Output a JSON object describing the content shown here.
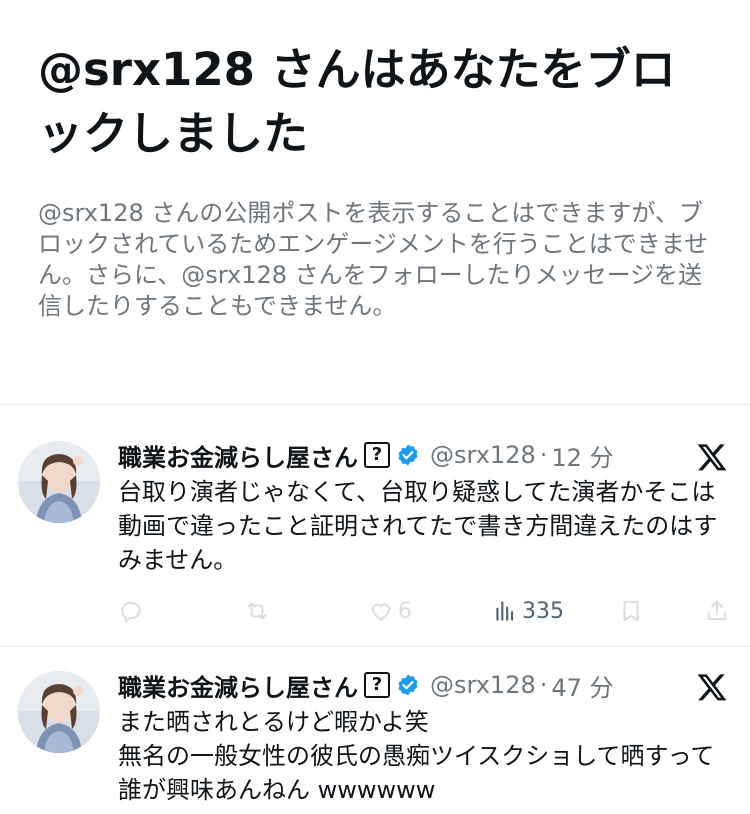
{
  "block_notice": {
    "title": "@srx128 さんはあなたをブロックしました",
    "description": "@srx128 さんの公開ポストを表示することはできますが、ブロックされているためエンゲージメントを行うことはできません。さらに、@srx128 さんをフォローしたりメッセージを送信したりすることもできません。"
  },
  "tweets": [
    {
      "display_name": "職業お金減らし屋さん",
      "emoji": "?",
      "handle": "@srx128",
      "separator": "·",
      "time": "12 分",
      "text": "台取り演者じゃなくて、台取り疑惑してた演者かそこは動画で違ったこと証明されてたで書き方間違えたのはすみません。",
      "likes": "6",
      "views": "335"
    },
    {
      "display_name": "職業お金減らし屋さん",
      "emoji": "?",
      "handle": "@srx128",
      "separator": "·",
      "time": "47 分",
      "text": "また晒されとるけど暇かよ笑\n無名の一般女性の彼氏の愚痴ツイスクショして晒すって誰が興味あんねん wwwwww"
    }
  ],
  "colors": {
    "text": "#0f1419",
    "secondary": "#6e767d",
    "verified": "#1d9bf0",
    "action_faded": "#d8dde1"
  }
}
